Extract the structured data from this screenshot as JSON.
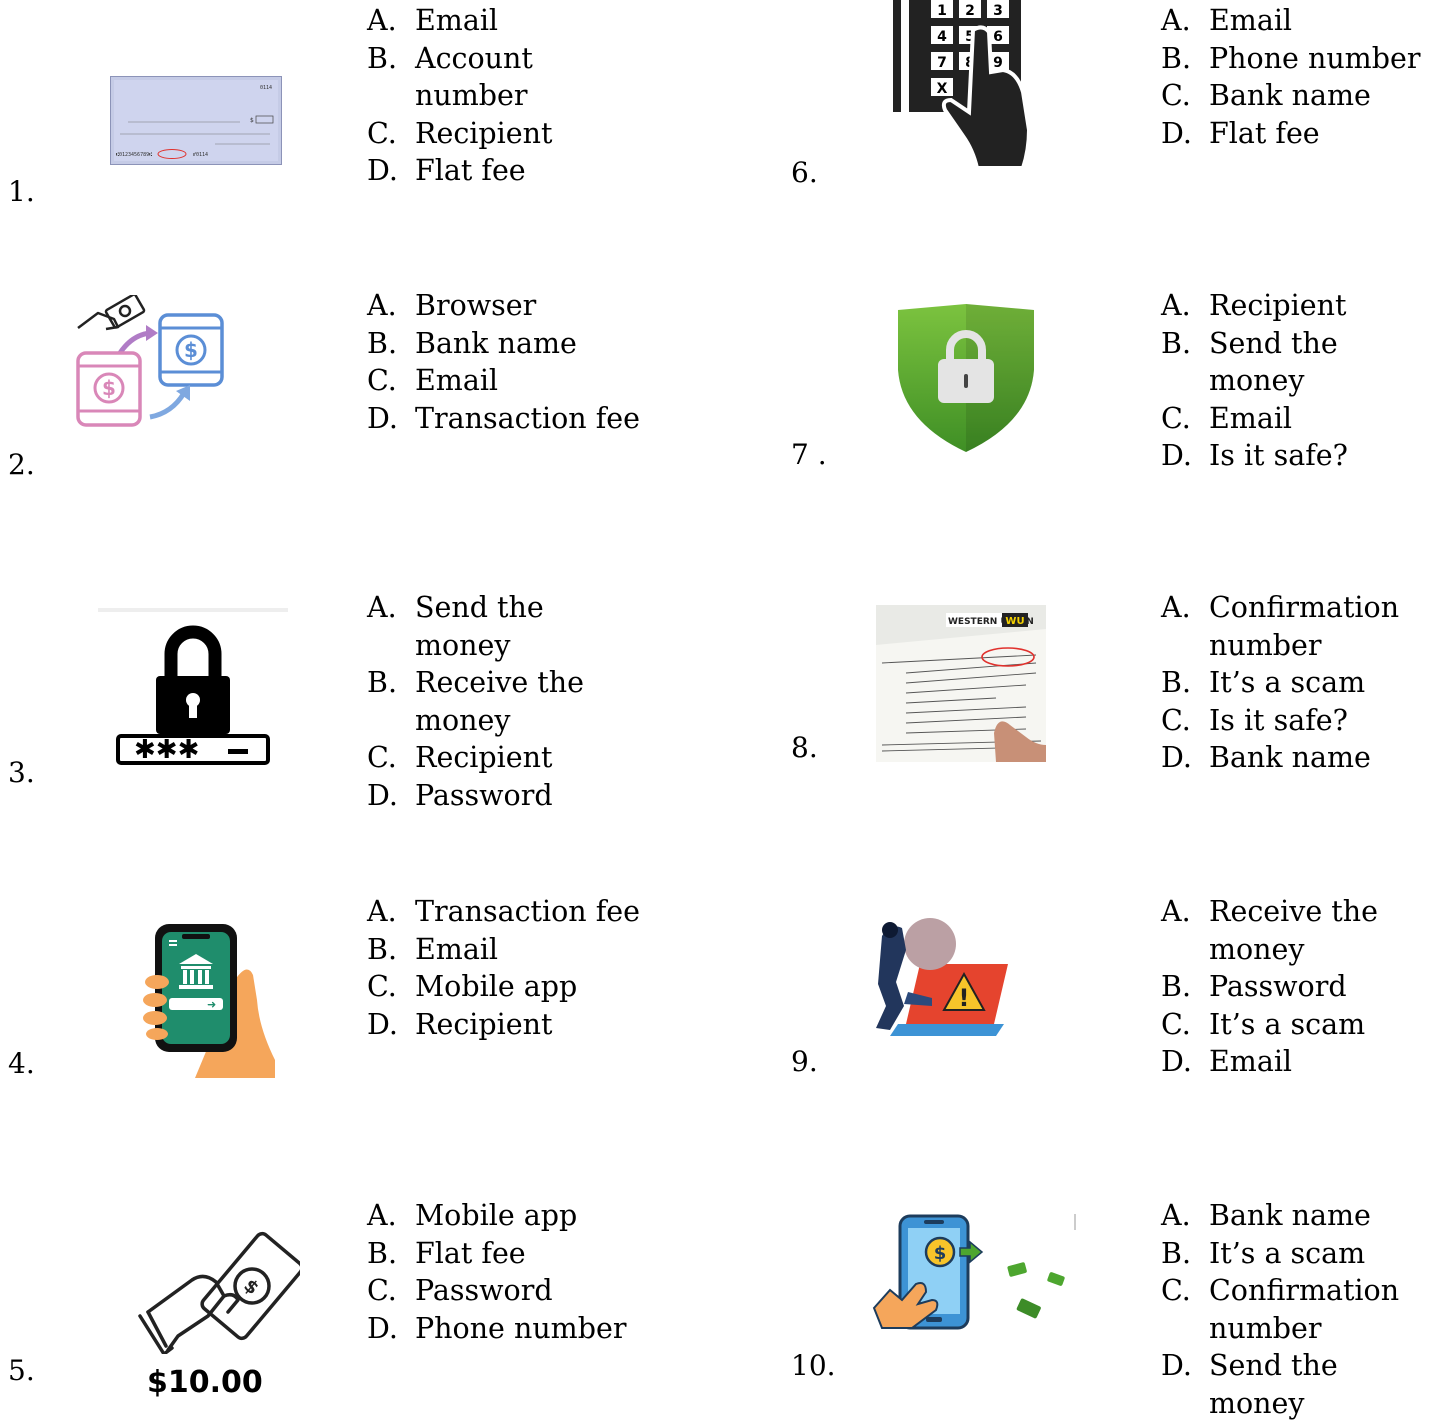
{
  "questions": [
    {
      "number": "1.",
      "image": "check-with-routing-number-icon",
      "options": [
        {
          "letter": "A.",
          "text": "Email"
        },
        {
          "letter": "B.",
          "text": "Account number"
        },
        {
          "letter": "C.",
          "text": "Recipient"
        },
        {
          "letter": "D.",
          "text": "Flat fee"
        }
      ]
    },
    {
      "number": "2.",
      "image": "phone-to-phone-transfer-icon",
      "options": [
        {
          "letter": "A.",
          "text": "Browser"
        },
        {
          "letter": "B.",
          "text": "Bank name"
        },
        {
          "letter": "C.",
          "text": "Email"
        },
        {
          "letter": "D.",
          "text": "Transaction fee"
        }
      ]
    },
    {
      "number": "3.",
      "image": "lock-password-icon",
      "options": [
        {
          "letter": "A.",
          "text": "Send the money"
        },
        {
          "letter": "B.",
          "text": "Receive the money"
        },
        {
          "letter": "C.",
          "text": "Recipient"
        },
        {
          "letter": "D.",
          "text": "Password"
        }
      ]
    },
    {
      "number": "4.",
      "image": "mobile-banking-app-icon",
      "options": [
        {
          "letter": "A.",
          "text": "Transaction fee"
        },
        {
          "letter": "B.",
          "text": "Email"
        },
        {
          "letter": "C.",
          "text": "Mobile app"
        },
        {
          "letter": "D.",
          "text": "Recipient"
        }
      ]
    },
    {
      "number": "5.",
      "image": "hand-with-money-icon",
      "caption": "$10.00",
      "options": [
        {
          "letter": "A.",
          "text": "Mobile app"
        },
        {
          "letter": "B.",
          "text": "Flat fee"
        },
        {
          "letter": "C.",
          "text": "Password"
        },
        {
          "letter": "D.",
          "text": "Phone number"
        }
      ]
    },
    {
      "number": "6.",
      "image": "keypad-pin-entry-icon",
      "keys": [
        "1",
        "2",
        "3",
        "4",
        "5",
        "6",
        "7",
        "8",
        "9",
        "X"
      ],
      "options": [
        {
          "letter": "A.",
          "text": "Email"
        },
        {
          "letter": "B.",
          "text": "Phone number"
        },
        {
          "letter": "C.",
          "text": "Bank name"
        },
        {
          "letter": "D.",
          "text": "Flat fee"
        }
      ]
    },
    {
      "number": "7 .",
      "image": "security-shield-lock-icon",
      "options": [
        {
          "letter": "A.",
          "text": "Recipient"
        },
        {
          "letter": "B.",
          "text": "Send the money"
        },
        {
          "letter": "C.",
          "text": "Email"
        },
        {
          "letter": "D.",
          "text": "Is it safe?"
        }
      ]
    },
    {
      "number": "8.",
      "image": "money-transfer-receipt-photo",
      "brand": "WESTERN UNION",
      "brand_mark": "WU",
      "options": [
        {
          "letter": "A.",
          "text": "Confirmation number"
        },
        {
          "letter": "B.",
          "text": "It’s a scam"
        },
        {
          "letter": "C.",
          "text": "Is it safe?"
        },
        {
          "letter": "D.",
          "text": "Bank name"
        }
      ]
    },
    {
      "number": "9.",
      "image": "thief-laptop-warning-icon",
      "options": [
        {
          "letter": "A.",
          "text": "Receive the money"
        },
        {
          "letter": "B.",
          "text": "Password"
        },
        {
          "letter": "C.",
          "text": "It’s a scam"
        },
        {
          "letter": "D.",
          "text": "Email"
        }
      ]
    },
    {
      "number": "10.",
      "image": "phone-send-money-icon",
      "options": [
        {
          "letter": "A.",
          "text": "Bank name"
        },
        {
          "letter": "B.",
          "text": "It’s a scam"
        },
        {
          "letter": "C.",
          "text": "Confirmation number"
        },
        {
          "letter": "D.",
          "text": "Send the money"
        }
      ]
    }
  ],
  "colors": {
    "green": "#4da62f",
    "phone_blue": "#3d93d5",
    "warning_red": "#e5442e",
    "teal": "#1f8d6c",
    "skin": "#f5a65b"
  }
}
